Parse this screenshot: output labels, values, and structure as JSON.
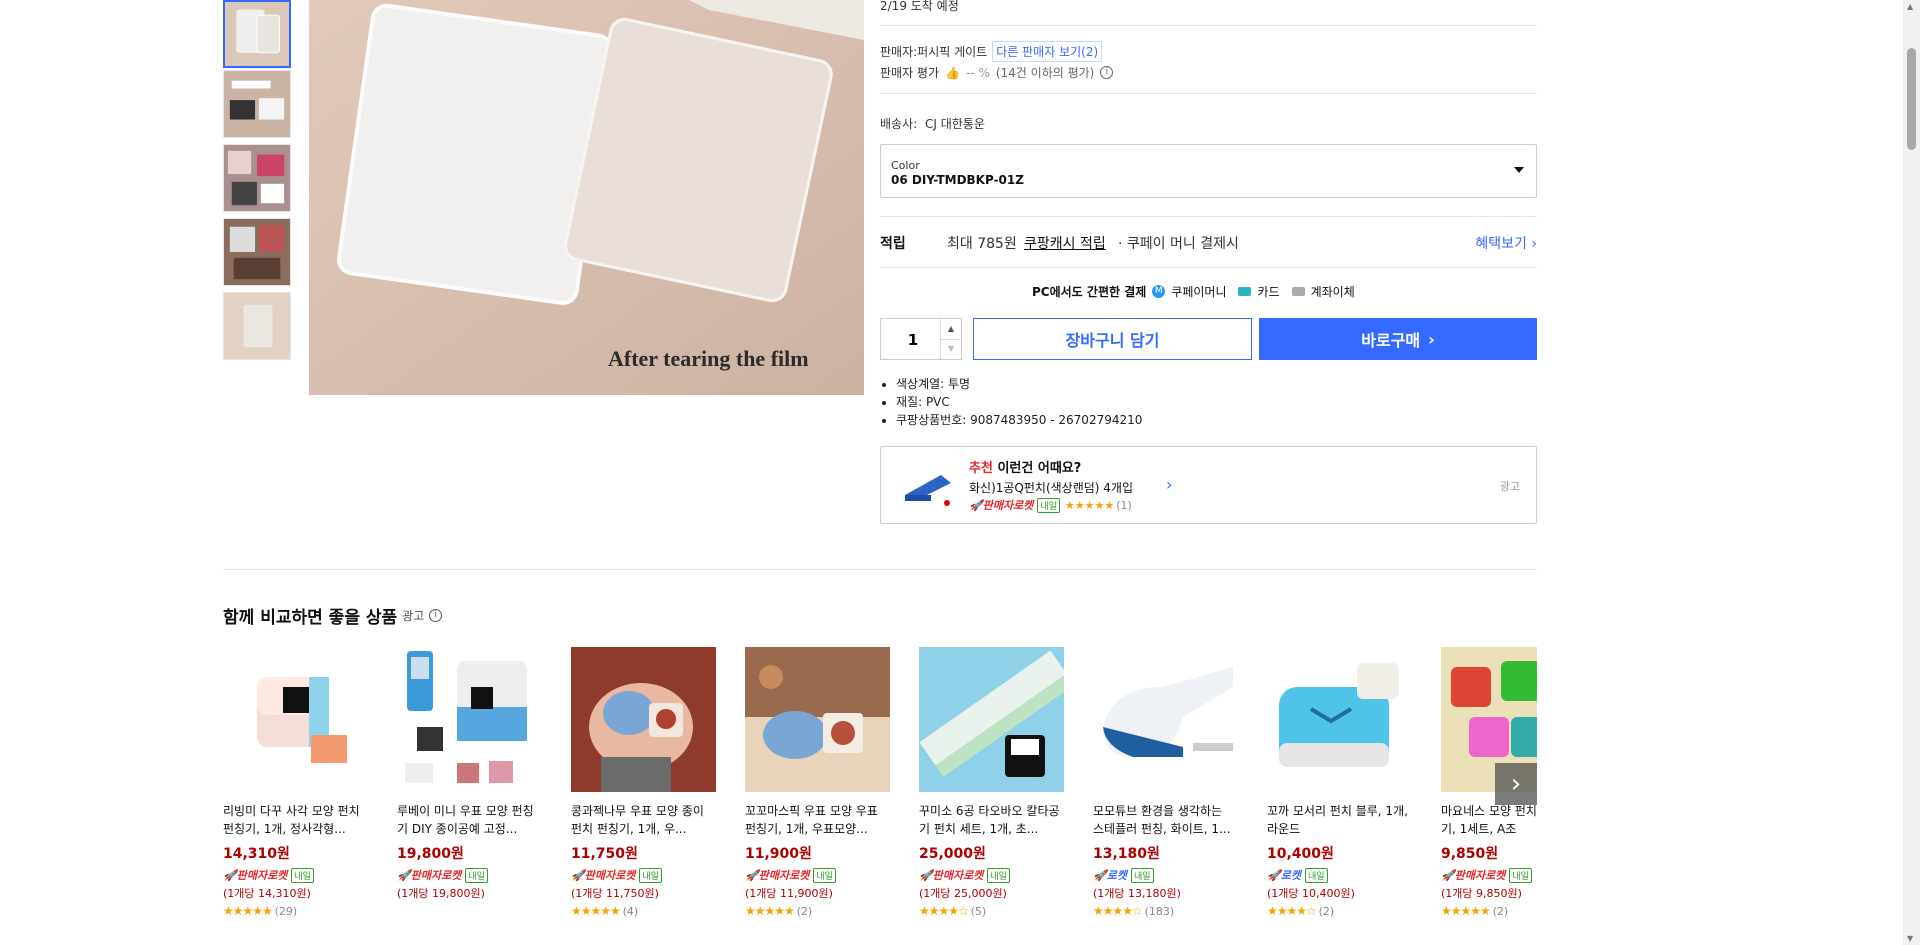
{
  "delivery": {
    "arrival_text": "2/19 도착 예정"
  },
  "seller": {
    "label": "판매자:",
    "name": "퍼시픽 게이트",
    "other_sellers": "다른 판매자 보기(2)",
    "rating_label": "판매자 평가",
    "rating_value": "-- %",
    "rating_count": "(14건 이하의 평가)"
  },
  "shipping": {
    "label": "배송사:",
    "carrier": "CJ 대한통운"
  },
  "option": {
    "label": "Color",
    "value": "06 DIY-TMDBKP-01Z"
  },
  "points": {
    "label": "적립",
    "max_text": "최대 785원",
    "cash_link": "쿠팡캐시 적립",
    "tail_text": "· 쿠페이 머니 결제시",
    "benefit_link": "혜택보기"
  },
  "payment": {
    "title": "PC에서도 간편한 결제",
    "methods": [
      "쿠페이머니",
      "카드",
      "계좌이체"
    ]
  },
  "purchase": {
    "quantity": "1",
    "cart_button": "장바구니 담기",
    "buy_button": "바로구매"
  },
  "specs": [
    "색상계열: 투명",
    "재질: PVC",
    "쿠팡상품번호: 9087483950 - 26702794210"
  ],
  "main_image": {
    "caption": "After tearing the film"
  },
  "recommend": {
    "tag": "추천",
    "question": "이런건 어때요?",
    "product_name": "화신)1공Q펀치(색상랜덤) 4개입",
    "badge": "판매자로켓",
    "badge_day": "내일",
    "stars": "★★★★★",
    "reviews": "(1)",
    "ad_label": "광고"
  },
  "compare": {
    "title": "함께 비교하면 좋을 상품",
    "ad_label": "광고",
    "products": [
      {
        "name": "리빙미 다꾸 사각 모양 펀치 펀칭기, 1개, 정사각형...",
        "price": "14,310원",
        "badge": "판매자로켓",
        "badge_type": "seller",
        "day": "내일",
        "unit": "(1개당 14,310원)",
        "stars": "★★★★★",
        "reviews": "(29)"
      },
      {
        "name": "루베이 미니 우표 모양 펀칭기 DIY 종이공예 고정...",
        "price": "19,800원",
        "badge": "판매자로켓",
        "badge_type": "seller",
        "day": "내일",
        "unit": "(1개당 19,800원)",
        "stars": "★★★★★",
        "reviews": ""
      },
      {
        "name": "콩과젝나무 우표 모양 종이 펀치 펀칭기, 1개, 우...",
        "price": "11,750원",
        "badge": "판매자로켓",
        "badge_type": "seller",
        "day": "내일",
        "unit": "(1개당 11,750원)",
        "stars": "★★★★★",
        "reviews": "(4)"
      },
      {
        "name": "꼬꼬마스픽 우표 모양 우표펀칭기, 1개, 우표모양...",
        "price": "11,900원",
        "badge": "판매자로켓",
        "badge_type": "seller",
        "day": "내일",
        "unit": "(1개당 11,900원)",
        "stars": "★★★★★",
        "reviews": "(2)"
      },
      {
        "name": "꾸미소 6공 타오바오 칼타공기 펀치 세트, 1개, 초...",
        "price": "25,000원",
        "badge": "판매자로켓",
        "badge_type": "seller",
        "day": "내일",
        "unit": "(1개당 25,000원)",
        "stars": "★★★★☆",
        "reviews": "(5)"
      },
      {
        "name": "모모튜브 환경을 생각하는 스테플러 펀칭, 화이트, 1...",
        "price": "13,180원",
        "badge": "로켓",
        "badge_type": "rocket",
        "day": "내일",
        "unit": "(1개당 13,180원)",
        "stars": "★★★★☆",
        "reviews": "(183)"
      },
      {
        "name": "꼬까 모서리 펀치 블루, 1개, 라운드",
        "price": "10,400원",
        "badge": "로켓",
        "badge_type": "rocket",
        "day": "내일",
        "unit": "(1개당 10,400원)",
        "stars": "★★★★☆",
        "reviews": "(2)"
      },
      {
        "name": "마요네스 모양 펀치기, 1세트, A조",
        "price": "9,850원",
        "badge": "판매자로켓",
        "badge_type": "seller",
        "day": "내일",
        "unit": "(1개당 9,850원)",
        "stars": "★★★★★",
        "reviews": "(2)"
      }
    ]
  },
  "colors": {
    "accent": "#346aff",
    "price": "#ae0000",
    "star": "#f6a200"
  }
}
